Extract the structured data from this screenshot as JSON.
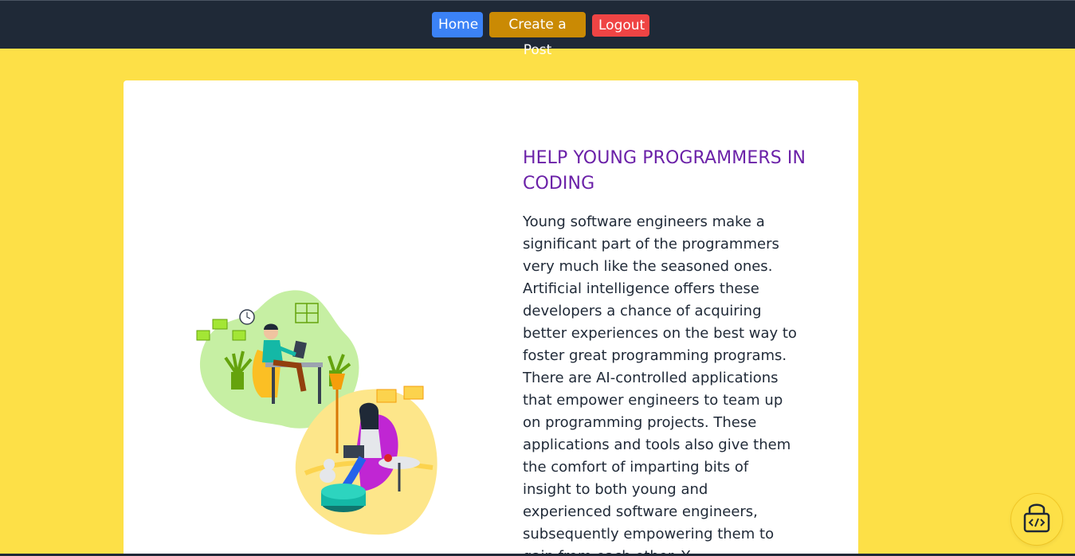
{
  "nav": {
    "home_label": "Home",
    "create_label": "Create a Post",
    "logout_label": "Logout"
  },
  "colors": {
    "navbar_bg": "#1f2937",
    "page_bg": "#fde047",
    "home_button": "#3b82f6",
    "create_button": "#ca8a04",
    "logout_button": "#ef4444",
    "heading": "#6b21a8"
  },
  "article": {
    "heading": "HELP YOUNG PROGRAMMERS IN CODING",
    "body": "Young software engineers make a significant part of the programmers very much like the seasoned ones. Artificial intelligence offers these developers a chance of acquiring better experiences on the best way to foster great programming programs. There are AI-controlled applications that empower engineers to team up on programming projects. These applications and tools also give them the comfort of imparting bits of insight to both young and experienced software engineers, subsequently empowering them to gain from each other. Y"
  },
  "icons": {
    "illustration": "people-coding-illustration",
    "badge": "lock-code-icon"
  }
}
